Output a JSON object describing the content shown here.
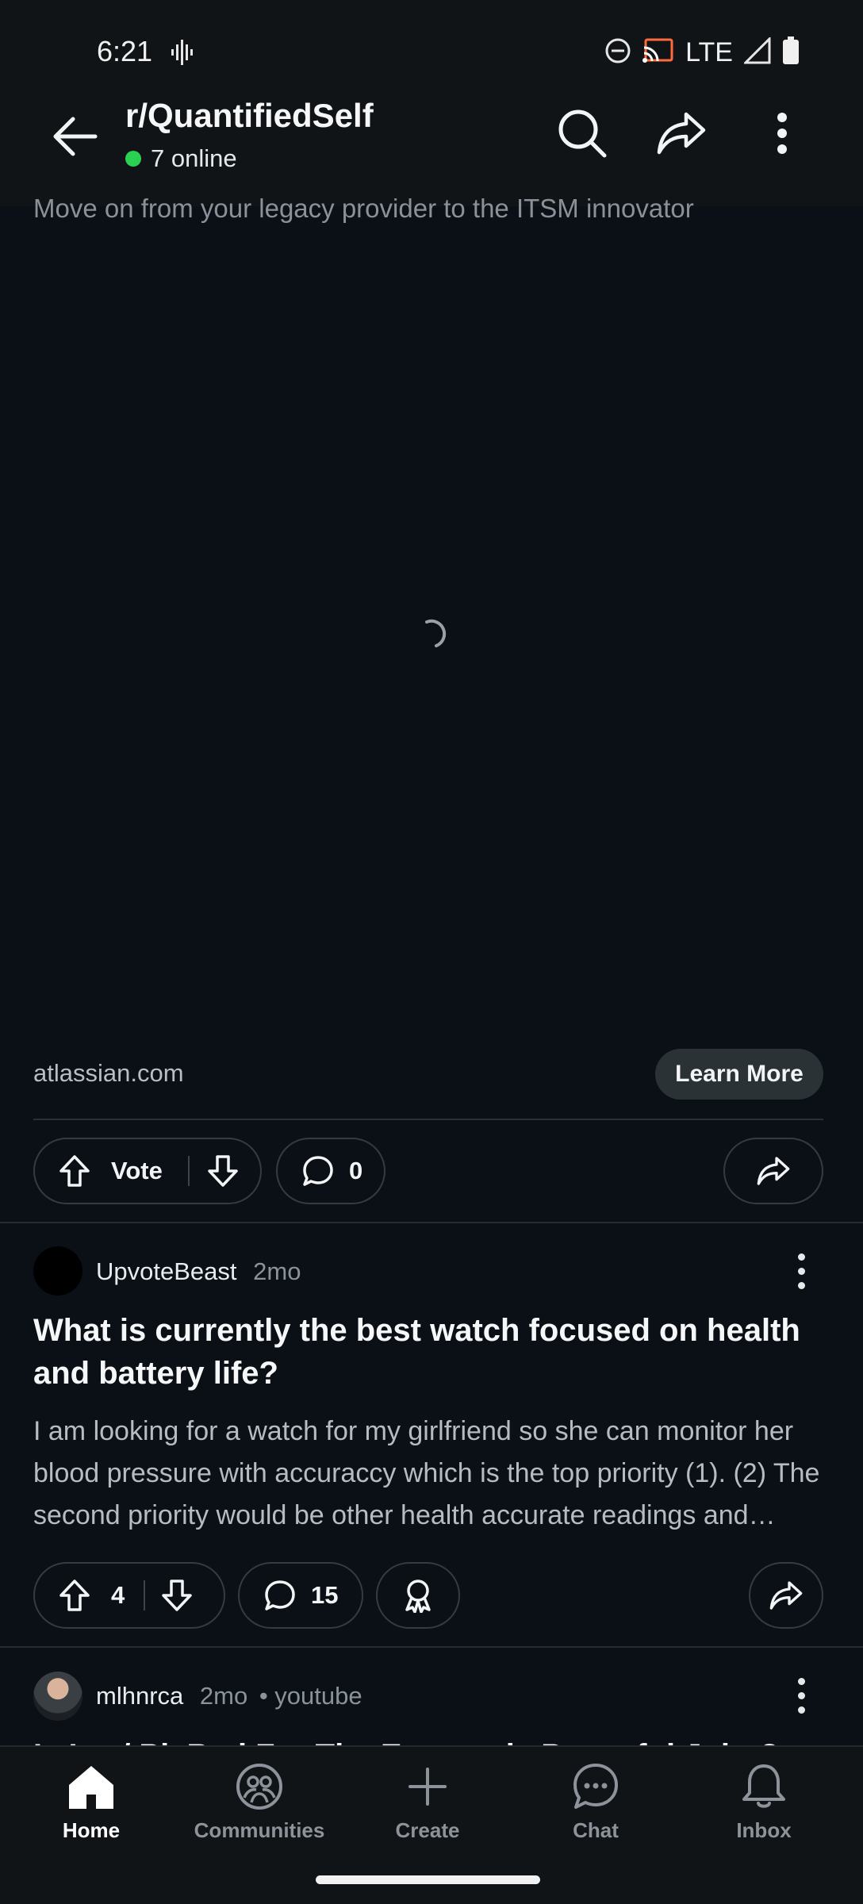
{
  "status_bar": {
    "time": "6:21",
    "network": "LTE"
  },
  "header": {
    "title": "r/QuantifiedSelf",
    "online_count": "7 online"
  },
  "ad": {
    "subtitle": "Move on from your legacy provider to the ITSM innovator",
    "domain": "atlassian.com",
    "cta_label": "Learn More",
    "vote_label": "Vote",
    "comment_count": "0"
  },
  "posts": [
    {
      "author": "UpvoteBeast",
      "age": "2mo",
      "title": "What is currently the best watch focused on health and battery life?",
      "body": "I am looking for a watch for my girlfriend so she can monitor her blood pressure with accuraccy which is the top priority (1). (2) The second priority would be other health accurate readings and battery life.",
      "score": "4",
      "comments": "15"
    },
    {
      "author": "mlhnrca",
      "age": "2mo",
      "source": "• youtube",
      "title": "Is Ice / Pl. Bad For The Extremely Powerful Joint?"
    }
  ],
  "nav": {
    "home": "Home",
    "communities": "Communities",
    "create": "Create",
    "chat": "Chat",
    "inbox": "Inbox"
  },
  "colors": {
    "online": "#2bd151",
    "background": "#0b1016",
    "accent_text": "#f6f7f8"
  }
}
